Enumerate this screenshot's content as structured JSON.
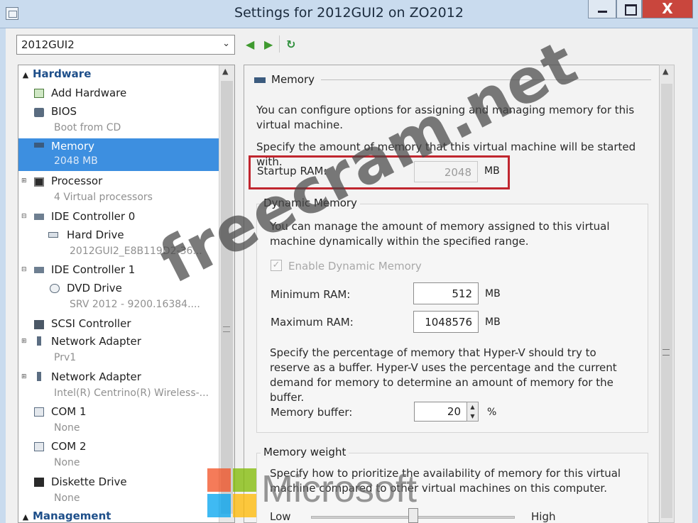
{
  "window": {
    "title": "Settings for 2012GUI2 on ZO2012",
    "close_label": "X"
  },
  "vm_selector": {
    "value": "2012GUI2",
    "arrow": "⌄"
  },
  "nav": {
    "back": "◀",
    "forward": "▶",
    "refresh": "↻"
  },
  "tree": {
    "hardware_label": "Hardware",
    "management_label": "Management",
    "items": [
      {
        "title": "Add Hardware",
        "sub": ""
      },
      {
        "title": "BIOS",
        "sub": "Boot from CD"
      },
      {
        "title": "Memory",
        "sub": "2048 MB"
      },
      {
        "title": "Processor",
        "sub": "4 Virtual processors"
      },
      {
        "title": "IDE Controller 0",
        "sub": ""
      },
      {
        "title": "Hard Drive",
        "sub": "2012GUI2_E8B119D2-36..."
      },
      {
        "title": "IDE Controller 1",
        "sub": ""
      },
      {
        "title": "DVD Drive",
        "sub": "SRV 2012 - 9200.16384...."
      },
      {
        "title": "SCSI Controller",
        "sub": ""
      },
      {
        "title": "Network Adapter",
        "sub": "Prv1"
      },
      {
        "title": "Network Adapter",
        "sub": "Intel(R) Centrino(R) Wireless-..."
      },
      {
        "title": "COM 1",
        "sub": "None"
      },
      {
        "title": "COM 2",
        "sub": "None"
      },
      {
        "title": "Diskette Drive",
        "sub": "None"
      }
    ]
  },
  "memory": {
    "section_title": "Memory",
    "intro": "You can configure options for assigning and managing memory for this virtual machine.",
    "specify": "Specify the amount of memory that this virtual machine will be started with.",
    "startup_label": "Startup RAM:",
    "startup_value": "2048",
    "unit": "MB",
    "dynamic": {
      "title": "Dynamic Memory",
      "desc": "You can manage the amount of memory assigned to this virtual machine dynamically within the specified range.",
      "enable_label": "Enable Dynamic Memory",
      "enabled": true,
      "min_label": "Minimum RAM:",
      "min_value": "512",
      "max_label": "Maximum RAM:",
      "max_value": "1048576",
      "buffer_desc": "Specify the percentage of memory that Hyper-V should try to reserve as a buffer. Hyper-V uses the percentage and the current demand for memory to determine an amount of memory for the buffer.",
      "buffer_label": "Memory buffer:",
      "buffer_value": "20",
      "buffer_unit": "%"
    },
    "weight": {
      "title": "Memory weight",
      "desc": "Specify how to prioritize the availability of memory for this virtual machine compared to other virtual machines on this computer.",
      "low": "Low",
      "high": "High",
      "level": 0.5
    }
  },
  "watermark": {
    "site": "freecram.net",
    "brand": "Microsoft",
    "logo_colors": [
      "#f25022",
      "#7fba00",
      "#00a4ef",
      "#ffb900"
    ]
  },
  "colors": {
    "selection": "#3d8fe0",
    "highlight_box": "#c0262f",
    "section_heading": "#1e4f8a"
  }
}
